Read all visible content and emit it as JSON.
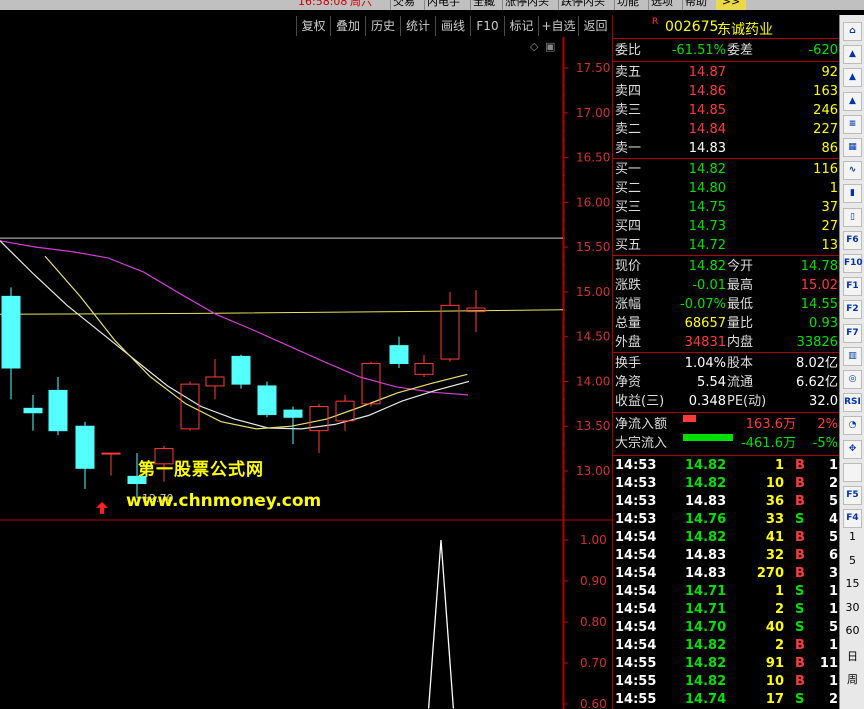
{
  "top_menu": {
    "time": "16:58:08",
    "day": "周六",
    "items": [
      "交易",
      "内电手",
      "全藏",
      "涨停内头",
      "跌停内头",
      "功能",
      "选项",
      "帮助"
    ],
    "arrows": ">>"
  },
  "toolbar": {
    "buttons": [
      "复权",
      "叠加",
      "历史",
      "统计",
      "画线",
      "F10",
      "标记",
      "+自选",
      "返回"
    ]
  },
  "chart": {
    "price_axis": [
      "17.50",
      "17.00",
      "16.50",
      "16.00",
      "15.50",
      "15.00",
      "14.50",
      "14.00",
      "13.50",
      "13.00"
    ],
    "low_marker": "12.70",
    "indicator_axis": [
      "1.00",
      "0.90",
      "0.80",
      "0.70",
      "0.60"
    ],
    "watermark_text": "第一股票公式网",
    "watermark_url": "www.chnmoney.com"
  },
  "chart_data": {
    "type": "candlestick",
    "ylim": [
      12.55,
      17.72
    ],
    "candles": [
      {
        "open": 14.15,
        "close": 14.95,
        "high": 15.05,
        "low": 13.8,
        "up": false
      },
      {
        "open": 13.7,
        "close": 13.65,
        "high": 13.85,
        "low": 13.45,
        "up": false
      },
      {
        "open": 13.45,
        "close": 13.9,
        "high": 14.05,
        "low": 13.4,
        "up": false
      },
      {
        "open": 13.5,
        "close": 13.03,
        "high": 13.55,
        "low": 12.8,
        "up": false
      },
      {
        "open": 13.2,
        "close": 13.2,
        "high": 13.2,
        "low": 12.95,
        "up": true
      },
      {
        "open": 12.94,
        "close": 12.86,
        "high": 13.2,
        "low": 12.7,
        "up": false
      },
      {
        "open": 13.08,
        "close": 13.25,
        "high": 13.28,
        "low": 12.88,
        "up": true
      },
      {
        "open": 13.47,
        "close": 13.97,
        "high": 14.0,
        "low": 13.45,
        "up": true
      },
      {
        "open": 13.95,
        "close": 14.05,
        "high": 14.25,
        "low": 13.8,
        "up": true
      },
      {
        "open": 13.97,
        "close": 14.28,
        "high": 14.3,
        "low": 13.92,
        "up": false
      },
      {
        "open": 13.63,
        "close": 13.95,
        "high": 14.0,
        "low": 13.6,
        "up": false
      },
      {
        "open": 13.6,
        "close": 13.68,
        "high": 13.72,
        "low": 13.3,
        "up": false
      },
      {
        "open": 13.45,
        "close": 13.72,
        "high": 13.75,
        "low": 13.2,
        "up": true
      },
      {
        "open": 13.56,
        "close": 13.78,
        "high": 13.85,
        "low": 13.45,
        "up": true
      },
      {
        "open": 13.75,
        "close": 14.2,
        "high": 14.22,
        "low": 13.72,
        "up": true
      },
      {
        "open": 14.2,
        "close": 14.4,
        "high": 14.5,
        "low": 14.15,
        "up": false
      },
      {
        "open": 14.08,
        "close": 14.2,
        "high": 14.3,
        "low": 14.05,
        "up": true
      },
      {
        "open": 14.25,
        "close": 14.85,
        "high": 15.0,
        "low": 14.22,
        "up": true
      },
      {
        "open": 14.82,
        "close": 14.78,
        "high": 15.02,
        "low": 14.55,
        "up": true
      }
    ],
    "ma_white": [
      15.57,
      15.2,
      14.85,
      14.55,
      14.25,
      13.95,
      13.72,
      13.58,
      13.48,
      13.47,
      13.52,
      13.62,
      13.78,
      13.9,
      14.0
    ],
    "ma_yellow": [
      15.4,
      14.95,
      14.45,
      14.05,
      13.75,
      13.55,
      13.47,
      13.5,
      13.58,
      13.72,
      13.87,
      13.98,
      14.08
    ],
    "ma_magenta": [
      15.57,
      15.5,
      15.45,
      15.38,
      15.22,
      14.98,
      14.75,
      14.58,
      14.4,
      14.22,
      14.05,
      13.94,
      13.88,
      13.85
    ],
    "resistance_yellow": 14.8,
    "resistance_white": 15.6,
    "indicator_peak": 1.0
  },
  "stock": {
    "r_mark": "R",
    "code": "002675",
    "name": "东诚药业"
  },
  "quote": {
    "weibi_label": "委比",
    "weibi": "-61.51%",
    "weicha_label": "委差",
    "weicha": "-620",
    "sell": [
      {
        "label": "卖五",
        "price": "14.87",
        "vol": "92"
      },
      {
        "label": "卖四",
        "price": "14.86",
        "vol": "163"
      },
      {
        "label": "卖三",
        "price": "14.85",
        "vol": "246"
      },
      {
        "label": "卖二",
        "price": "14.84",
        "vol": "227"
      },
      {
        "label": "卖一",
        "price": "14.83",
        "vol": "86"
      }
    ],
    "buy": [
      {
        "label": "买一",
        "price": "14.82",
        "vol": "116"
      },
      {
        "label": "买二",
        "price": "14.80",
        "vol": "1"
      },
      {
        "label": "买三",
        "price": "14.75",
        "vol": "37"
      },
      {
        "label": "买四",
        "price": "14.73",
        "vol": "27"
      },
      {
        "label": "买五",
        "price": "14.72",
        "vol": "13"
      }
    ],
    "stats": [
      {
        "l1": "现价",
        "v1": "14.82",
        "l2": "今开",
        "v2": "14.78"
      },
      {
        "l1": "涨跌",
        "v1": "-0.01",
        "l2": "最高",
        "v2": "15.02"
      },
      {
        "l1": "涨幅",
        "v1": "-0.07%",
        "l2": "最低",
        "v2": "14.55"
      },
      {
        "l1": "总量",
        "v1": "68657",
        "l2": "量比",
        "v2": "0.93"
      },
      {
        "l1": "外盘",
        "v1": "34831",
        "l2": "内盘",
        "v2": "33826"
      }
    ],
    "stats2": [
      {
        "l1": "换手",
        "v1": "1.04%",
        "l2": "股本",
        "v2": "8.02亿"
      },
      {
        "l1": "净资",
        "v1": "5.54",
        "l2": "流通",
        "v2": "6.62亿"
      },
      {
        "l1": "收益(三)",
        "v1": "0.348",
        "l2": "PE(动)",
        "v2": "32.0"
      }
    ],
    "flow": [
      {
        "label": "净流入额",
        "val": "163.6万",
        "pct": "2%",
        "color": "#ff3c3c",
        "ratio": 0.26
      },
      {
        "label": "大宗流入",
        "val": "-461.6万",
        "pct": "-5%",
        "color": "#00e000",
        "ratio": 1.0
      }
    ]
  },
  "ticks": [
    {
      "time": "14:53",
      "price": "14.82",
      "vol": "1",
      "bs": "B",
      "n": "1"
    },
    {
      "time": "14:53",
      "price": "14.82",
      "vol": "10",
      "bs": "B",
      "n": "2"
    },
    {
      "time": "14:53",
      "price": "14.83",
      "vol": "36",
      "bs": "B",
      "n": "5"
    },
    {
      "time": "14:53",
      "price": "14.76",
      "vol": "33",
      "bs": "S",
      "n": "4"
    },
    {
      "time": "14:54",
      "price": "14.82",
      "vol": "41",
      "bs": "B",
      "n": "5"
    },
    {
      "time": "14:54",
      "price": "14.83",
      "vol": "32",
      "bs": "B",
      "n": "6"
    },
    {
      "time": "14:54",
      "price": "14.83",
      "vol": "270",
      "bs": "B",
      "n": "3"
    },
    {
      "time": "14:54",
      "price": "14.71",
      "vol": "1",
      "bs": "S",
      "n": "1"
    },
    {
      "time": "14:54",
      "price": "14.71",
      "vol": "2",
      "bs": "S",
      "n": "1"
    },
    {
      "time": "14:54",
      "price": "14.70",
      "vol": "40",
      "bs": "S",
      "n": "5"
    },
    {
      "time": "14:54",
      "price": "14.82",
      "vol": "2",
      "bs": "B",
      "n": "1"
    },
    {
      "time": "14:55",
      "price": "14.82",
      "vol": "91",
      "bs": "B",
      "n": "11"
    },
    {
      "time": "14:55",
      "price": "14.82",
      "vol": "10",
      "bs": "B",
      "n": "1"
    },
    {
      "time": "14:55",
      "price": "14.74",
      "vol": "17",
      "bs": "S",
      "n": "2"
    }
  ],
  "sidebar": {
    "numbers": [
      "1",
      "5",
      "15",
      "30",
      "60",
      "日",
      "周"
    ],
    "icons": [
      "home-icon",
      "up-icon",
      "up-icon",
      "up-icon",
      "list-icon",
      "grid-icon",
      "curve-icon",
      "kline-icon",
      "candle-icon",
      "f6-icon",
      "f10-icon",
      "f1-icon",
      "f2-icon",
      "f7-icon",
      "bars-icon",
      "radar-icon",
      "rsi-icon",
      "pie-icon",
      "move-icon",
      "blank-icon",
      "f5-icon",
      "f4-icon"
    ],
    "icon_texts": [
      "⌂",
      "▲",
      "▲",
      "▲",
      "≡",
      "▦",
      "∿",
      "▮",
      "▯",
      "F6",
      "F10",
      "F1",
      "F2",
      "F7",
      "▥",
      "◎",
      "RSI",
      "◔",
      "✥",
      "",
      "F5",
      "F4"
    ]
  }
}
